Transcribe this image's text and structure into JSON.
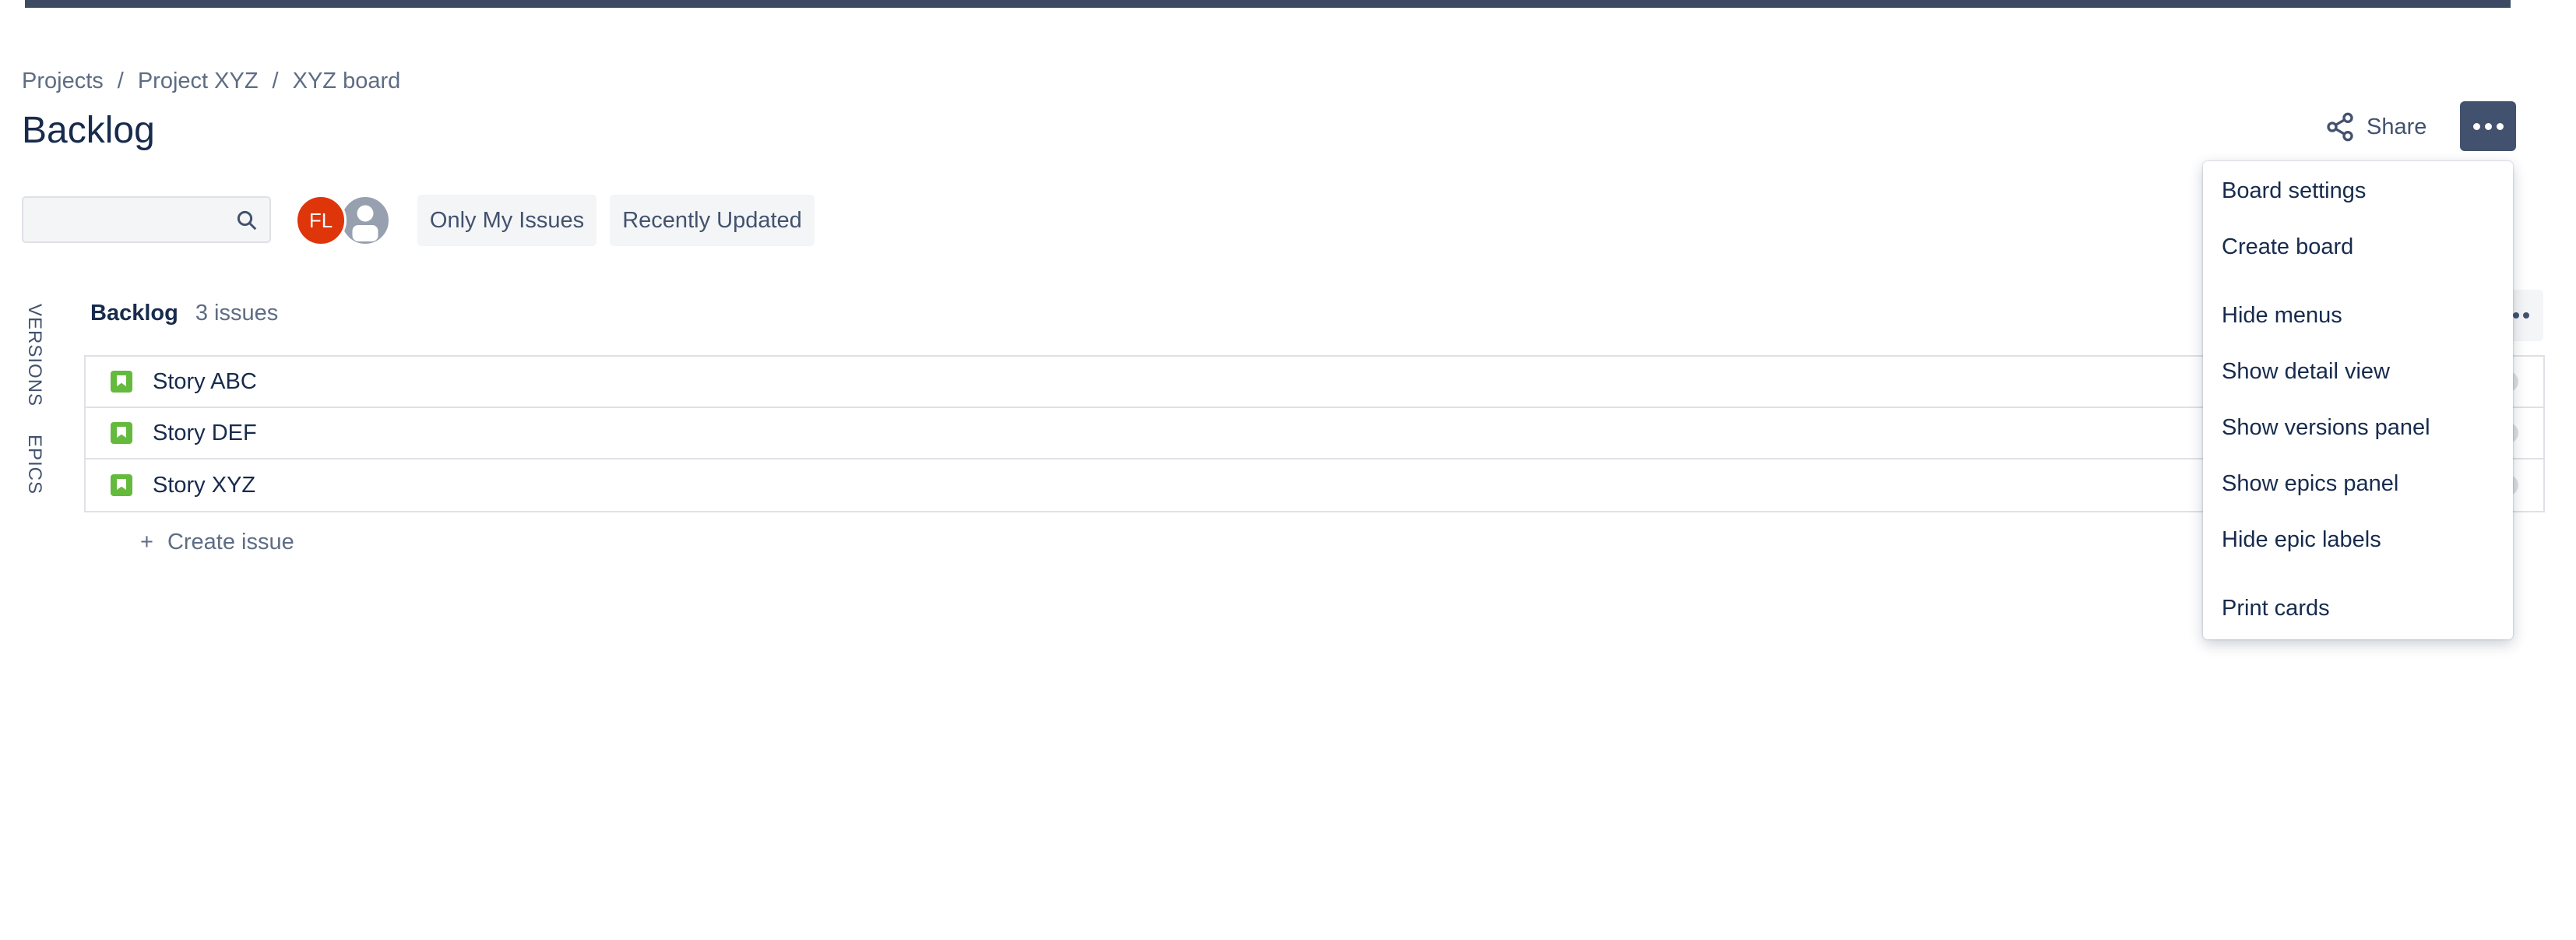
{
  "breadcrumbs": [
    "Projects",
    "Project XYZ",
    "XYZ board"
  ],
  "breadcrumb_separator": "/",
  "page_title": "Backlog",
  "header": {
    "share_label": "Share",
    "share_icon": "share-icon",
    "more_icon": "more-horizontal-icon"
  },
  "search": {
    "value": "",
    "placeholder": "",
    "icon": "search-icon"
  },
  "avatars": [
    {
      "initials": "FL",
      "color": "#de350b"
    },
    {
      "initials": "",
      "icon": "user-avatar-icon",
      "color": "#97a0af"
    }
  ],
  "quick_filters": [
    "Only My Issues",
    "Recently Updated"
  ],
  "side_tabs": [
    "VERSIONS",
    "EPICS"
  ],
  "backlog": {
    "label": "Backlog",
    "count_label": "3 issues",
    "issues": [
      {
        "summary": "Story ABC",
        "type_icon": "story-icon"
      },
      {
        "summary": "Story DEF",
        "type_icon": "story-icon"
      },
      {
        "summary": "Story XYZ",
        "type_icon": "story-icon"
      }
    ],
    "create_issue_plus": "+",
    "create_issue_label": "Create issue"
  },
  "dropdown_menu": {
    "items": [
      "Board settings",
      "Create board",
      "Hide menus",
      "Show detail view",
      "Show versions panel",
      "Show epics panel",
      "Hide epic labels",
      "Print cards"
    ]
  },
  "colors": {
    "topbar": "#3d4a63",
    "primary_button": "#42526e",
    "story_icon": "#63ba3c",
    "avatar_fl": "#de350b",
    "text": "#172b4d",
    "subtle_text": "#5e6c84"
  }
}
